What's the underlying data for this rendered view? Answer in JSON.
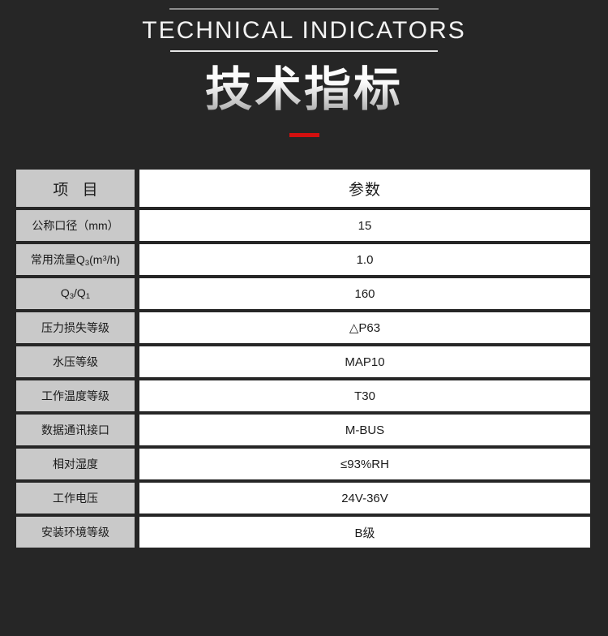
{
  "header": {
    "title_en": "TECHNICAL INDICATORS",
    "title_cn": "技术指标",
    "accent_color": "#d2100f"
  },
  "table": {
    "columns": [
      "项 目",
      "参数"
    ],
    "rows": [
      {
        "label": "公称口径（mm）",
        "value": "15"
      },
      {
        "label_html": "常用流量Q<sub>3</sub>(m<sup>3</sup>/h)",
        "label": "常用流量Q3(m3/h)",
        "value": "1.0"
      },
      {
        "label_html": "Q<sub>3</sub>/Q<sub>1</sub>",
        "label": "Q3/Q1",
        "value": "160"
      },
      {
        "label": "压力损失等级",
        "value": "△P63"
      },
      {
        "label": "水压等级",
        "value": "MAP10"
      },
      {
        "label": "工作温度等级",
        "value": "T30"
      },
      {
        "label": "数据通讯接口",
        "value": "M-BUS"
      },
      {
        "label": "相对湿度",
        "value": "≤93%RH"
      },
      {
        "label": "工作电压",
        "value": "24V-36V"
      },
      {
        "label": "安装环境等级",
        "value": "B级"
      }
    ]
  },
  "colors": {
    "background": "#262626",
    "label_cell": "#c9c9c9",
    "value_cell": "#ffffff",
    "text_dark": "#1b1b1b",
    "text_light": "#f2f2f2",
    "accent_red": "#d2100f"
  }
}
